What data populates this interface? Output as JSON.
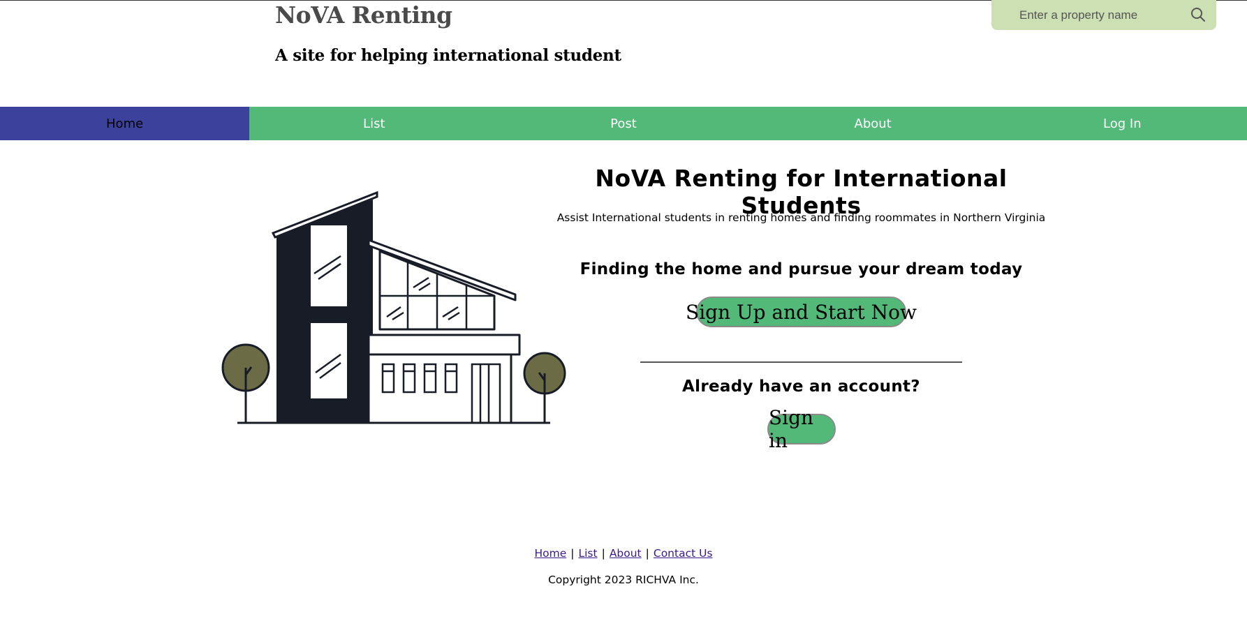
{
  "header": {
    "title": "NoVA Renting",
    "subtitle": "A site for helping international student"
  },
  "search": {
    "placeholder": "Enter a property name",
    "icon": "search-icon"
  },
  "nav": {
    "active": "Home",
    "items": [
      {
        "label": "Home"
      },
      {
        "label": "List"
      },
      {
        "label": "Post"
      },
      {
        "label": "About"
      },
      {
        "label": "Log In"
      }
    ]
  },
  "hero": {
    "illustration": "modern-house-illustration",
    "title": "NoVA Renting for International Students",
    "description": "Assist International students in renting homes and finding roommates in Northern Virginia",
    "tagline": "Finding the home and pursue your dream today",
    "signup_label": "Sign Up and Start Now",
    "account_question": "Already have an account?",
    "signin_label": "Sign in"
  },
  "footer": {
    "links": [
      {
        "label": "Home"
      },
      {
        "label": "List"
      },
      {
        "label": "About"
      },
      {
        "label": "Contact Us"
      }
    ],
    "separator": "|",
    "copyright": "Copyright 2023 RICHVA Inc."
  },
  "colors": {
    "nav_green": "#53b978",
    "nav_active": "#3c429b",
    "search_bg": "#cde0b4",
    "button_green": "#53b978",
    "footer_link": "#3a1a8a",
    "tree": "#6b6b45",
    "building_dark": "#181c26"
  }
}
